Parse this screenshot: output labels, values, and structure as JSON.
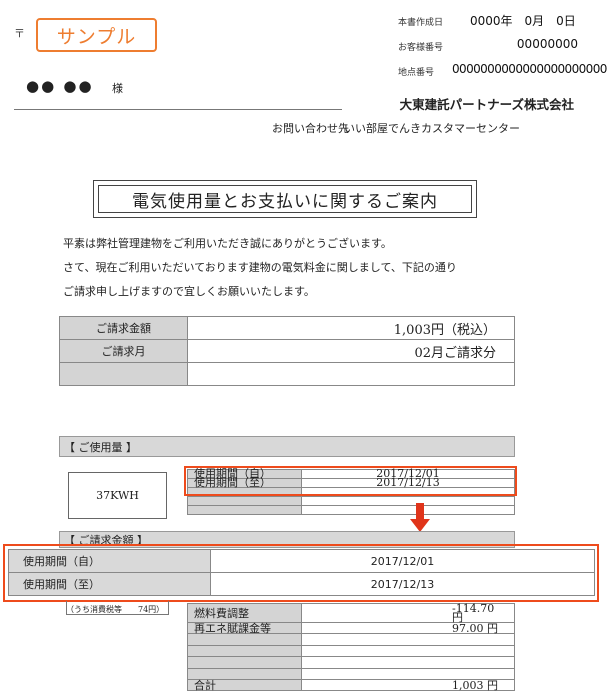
{
  "sample_badge": "サンプル",
  "postal_mark": "〒",
  "recipient": {
    "name": "●● ●●",
    "honorific": "様"
  },
  "meta": {
    "created_label": "本書作成日",
    "created_value": "0000年　0月　0日",
    "customer_label": "お客様番号",
    "customer_value": "00000000",
    "location_label": "地点番号",
    "location_value": "0000000000000000000000"
  },
  "company": "大東建託パートナーズ株式会社",
  "contact": {
    "label": "お問い合わせ先",
    "value": "いい部屋でんきカスタマーセンター"
  },
  "title": "電気使用量とお支払いに関するご案内",
  "intro": [
    "平素は弊社管理建物をご利用いただき誠にありがとうございます。",
    "さて、現在ご利用いただいております建物の電気料金に関しまして、下記の通り",
    "ご請求申し上げますので宜しくお願いいたします。"
  ],
  "billing": {
    "amount_label": "ご請求金額",
    "amount_value": "1,003円（税込）",
    "month_label": "ご請求月",
    "month_value": "02月ご請求分"
  },
  "usage": {
    "section_label": "【 ご使用量 】",
    "kwh": "37KWH",
    "period_from_label": "使用期間（自）",
    "period_from_value": "2017/12/01",
    "period_to_label": "使用期間（至）",
    "period_to_value": "2017/12/13"
  },
  "charges_section_label": "【 ご請求金額 】",
  "tax_note": "（うち消費税等　　74円）",
  "charges": {
    "fuel_label": "燃料費調整",
    "fuel_value": "-114.70 円",
    "renew_label": "再エネ賦課金等",
    "renew_value": "97.00 円",
    "total_label": "合計",
    "total_value": "1,003 円"
  }
}
